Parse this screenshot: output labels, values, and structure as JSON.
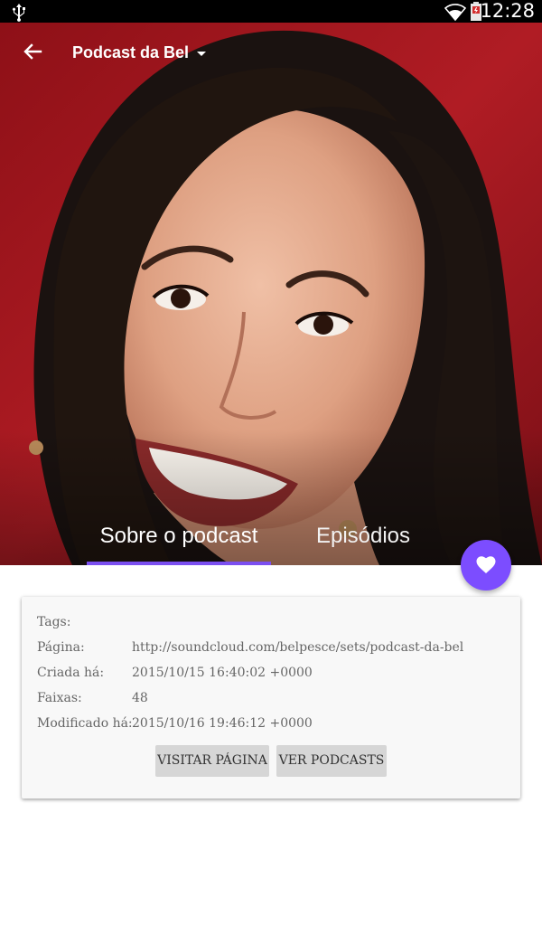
{
  "status_bar": {
    "time": "12:28"
  },
  "app_bar": {
    "title": "Podcast da Bel"
  },
  "tabs": [
    {
      "label": "Sobre o podcast",
      "selected": true
    },
    {
      "label": "Episódios",
      "selected": false
    }
  ],
  "info": {
    "tags": {
      "label": "Tags:",
      "value": ""
    },
    "page": {
      "label": "Página:",
      "value": "http://soundcloud.com/belpesce/sets/podcast-da-bel"
    },
    "created": {
      "label": "Criada há:",
      "value": "2015/10/15 16:40:02 +0000"
    },
    "tracks": {
      "label": "Faixas:",
      "value": "48"
    },
    "modified": {
      "label": "Modificado há:",
      "value": "2015/10/16 19:46:12 +0000"
    }
  },
  "buttons": {
    "visit": "VISITAR PÁGINA",
    "podcasts": "VER PODCASTS"
  },
  "colors": {
    "accent": "#7c4dff",
    "tab_indicator": "#7b4ff0",
    "status_bar": "#000000"
  },
  "icons": {
    "back": "arrow-left-icon",
    "dropdown": "caret-down-icon",
    "favorite": "heart-icon",
    "usb": "usb-icon",
    "wifi": "wifi-icon",
    "battery": "battery-icon"
  }
}
